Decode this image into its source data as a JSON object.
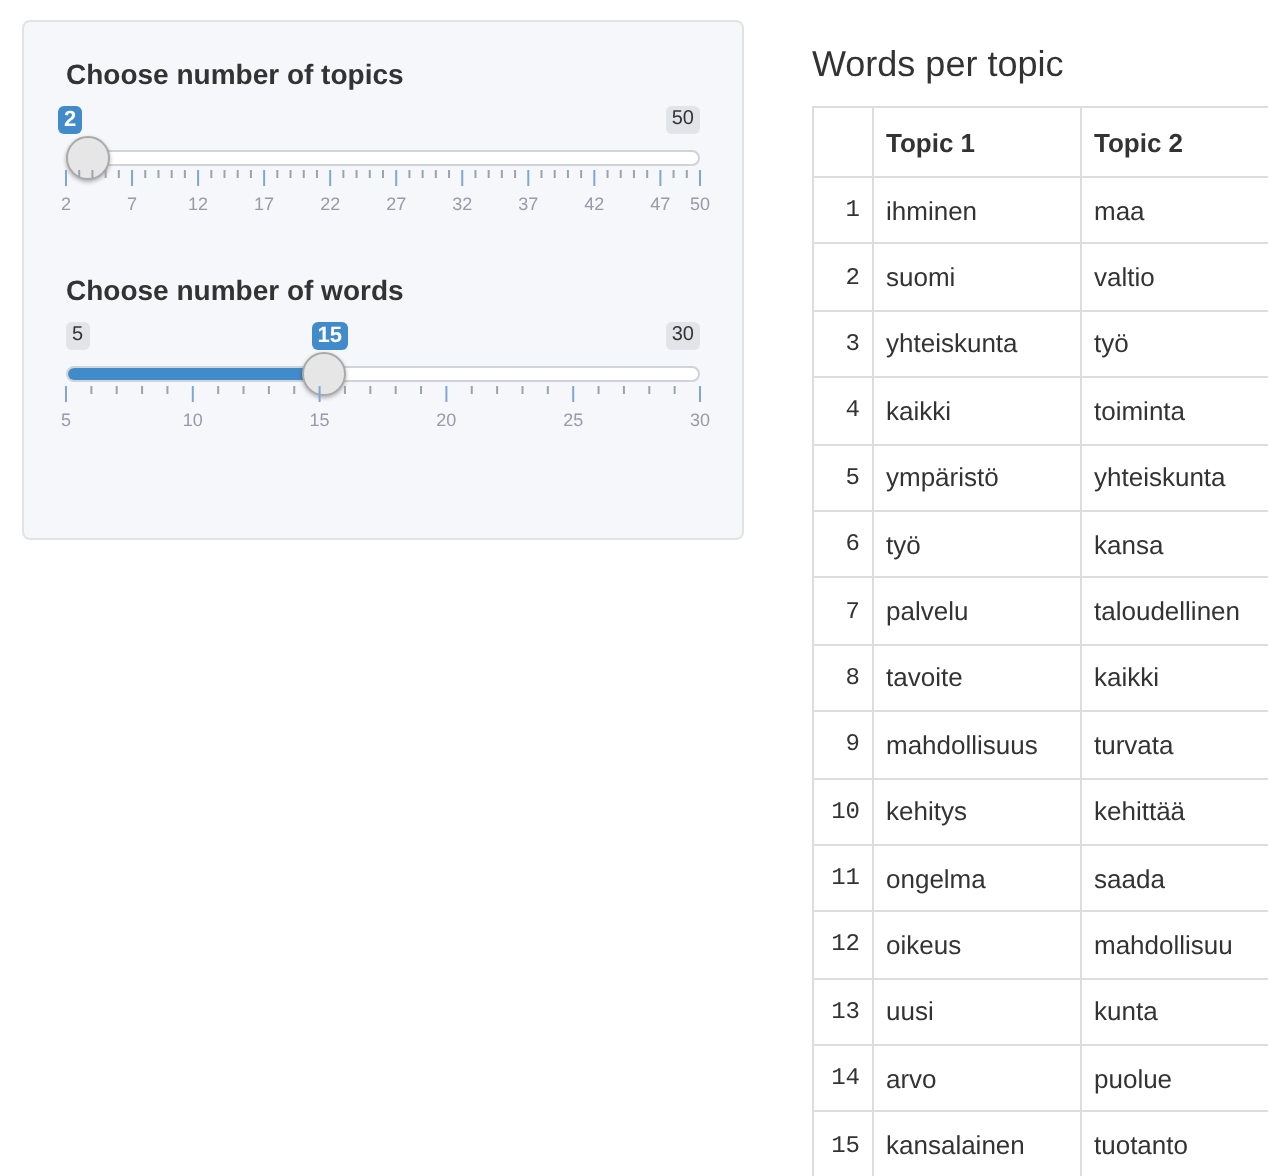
{
  "sliders": [
    {
      "label": "Choose number of topics",
      "value_label": "2",
      "max_label": "50",
      "level": 0,
      "ticks": [
        "2",
        "7",
        "12",
        "17",
        "22",
        "27",
        "32",
        "37",
        "42",
        "47",
        "50"
      ]
    },
    {
      "label": "Choose number of words",
      "min_label": "5",
      "value_label": "15",
      "max_label": "30",
      "level": 0.4,
      "ticks": [
        "5",
        "10",
        "15",
        "20",
        "25",
        "30"
      ]
    }
  ],
  "table": {
    "title": "Words per topic",
    "columns": [
      "",
      "Topic 1",
      "Topic 2"
    ],
    "rows": [
      [
        "1",
        "ihminen",
        "maa"
      ],
      [
        "2",
        "suomi",
        "valtio"
      ],
      [
        "3",
        "yhteiskunta",
        "työ"
      ],
      [
        "4",
        "kaikki",
        "toiminta"
      ],
      [
        "5",
        "ympäristö",
        "yhteiskunta"
      ],
      [
        "6",
        "työ",
        "kansa"
      ],
      [
        "7",
        "palvelu",
        "taloudellinen"
      ],
      [
        "8",
        "tavoite",
        "kaikki"
      ],
      [
        "9",
        "mahdollisuus",
        "turvata"
      ],
      [
        "10",
        "kehitys",
        "kehittää"
      ],
      [
        "11",
        "ongelma",
        "saada"
      ],
      [
        "12",
        "oikeus",
        "mahdollisuu"
      ],
      [
        "13",
        "uusi",
        "kunta"
      ],
      [
        "14",
        "arvo",
        "puolue"
      ],
      [
        "15",
        "kansalainen",
        "tuotanto"
      ]
    ]
  }
}
